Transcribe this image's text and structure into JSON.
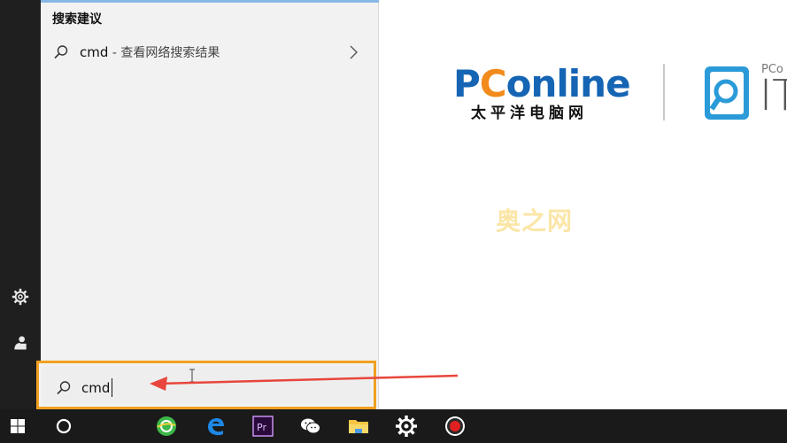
{
  "search_panel": {
    "section_title": "搜索建议",
    "suggestion": {
      "query": "cmd",
      "sub": " - 查看网络搜索结果"
    },
    "input_value": "cmd"
  },
  "branding": {
    "logo_p": "P",
    "logo_c": "C",
    "logo_rest": "online",
    "logo_cn": "太平洋电脑网",
    "it_small": "PCo",
    "it_big": "IT",
    "watermark": "奥之网"
  },
  "colors": {
    "highlight_border": "#f0a020",
    "arrow": "#e8463c",
    "brand_blue": "#1565b4",
    "brand_orange": "#f28a1c"
  },
  "taskbar_icons": [
    "windows-start-icon",
    "cortana-circle-icon",
    "browser-360-icon",
    "edge-icon",
    "premiere-pr-icon",
    "wechat-icon",
    "file-explorer-icon",
    "settings-gear-icon",
    "record-icon"
  ],
  "taskbar": {
    "premiere_label": "Pr"
  }
}
